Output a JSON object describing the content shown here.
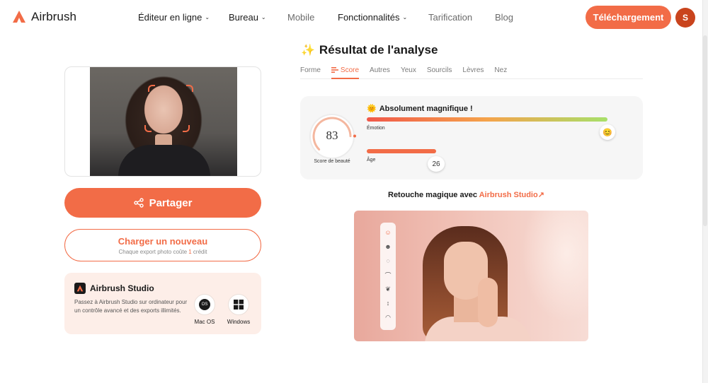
{
  "brand": {
    "name": "Airbrush",
    "accent": "#f26c47"
  },
  "nav": {
    "items": [
      {
        "label": "Éditeur en ligne",
        "dropdown": true
      },
      {
        "label": "Bureau",
        "dropdown": true
      },
      {
        "label": "Mobile",
        "dropdown": false
      },
      {
        "label": "Fonctionnalités",
        "dropdown": true
      },
      {
        "label": "Tarification",
        "dropdown": false
      },
      {
        "label": "Blog",
        "dropdown": false
      }
    ],
    "download_label": "Téléchargement",
    "avatar_initial": "S"
  },
  "left": {
    "share_label": "Partager",
    "upload_title": "Charger un nouveau",
    "upload_sub_prefix": "Chaque export photo coûte ",
    "upload_sub_count": "1",
    "upload_sub_suffix": " crédit",
    "studio": {
      "title": "Airbrush Studio",
      "description": "Passez à Airbrush Studio sur ordinateur pour un contrôle avancé et des exports illimités.",
      "mac_label": "Mac OS",
      "mac_icon_text": "OS",
      "windows_label": "Windows"
    }
  },
  "analysis": {
    "title": "Résultat de l'analyse",
    "tabs": [
      "Forme",
      "Score",
      "Autres",
      "Yeux",
      "Sourcils",
      "Lèvres",
      "Nez"
    ],
    "active_tab": "Score",
    "score": {
      "value": "83",
      "label": "Score de beauté",
      "max": 100
    },
    "verdict": "Absolument magnifique !",
    "emotion_label": "Émotion",
    "emotion_level": 1.0,
    "age_label": "Âge",
    "age_value": "26"
  },
  "promo": {
    "text_prefix": "Retouche magique avec ",
    "link_label": "Airbrush Studio"
  },
  "icons": [
    "airbrush-logo-icon",
    "chevron-down-icon",
    "share-icon",
    "apple-icon",
    "windows-icon",
    "sparkle-icon",
    "sun-icon",
    "smile-icon",
    "score-icon",
    "arrow-up-right-icon"
  ]
}
